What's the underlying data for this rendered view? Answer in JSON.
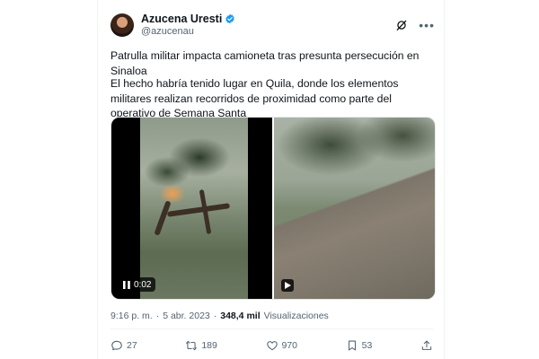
{
  "user": {
    "display_name": "Azucena Uresti",
    "handle": "@azucenau"
  },
  "post": {
    "line1": "Patrulla militar impacta camioneta tras presunta persecución en Sinaloa",
    "line2": "El hecho habría tenido lugar en Quila, donde los elementos militares realizan recorridos de proximidad como parte del operativo de Semana Santa"
  },
  "media": {
    "video1_time": "0:02"
  },
  "meta": {
    "time": "9:16 p. m.",
    "separator": "·",
    "date": "5 abr. 2023",
    "views_separator": "·",
    "views_count": "348,4 mil",
    "views_label": "Visualizaciones"
  },
  "actions": {
    "replies": "27",
    "reposts": "189",
    "likes": "970",
    "bookmarks": "53"
  },
  "icons": [
    "avatar",
    "verified-icon",
    "grok-icon",
    "more-icon",
    "pause-icon",
    "play-icon",
    "reply-icon",
    "repost-icon",
    "like-icon",
    "bookmark-icon",
    "share-icon"
  ],
  "colors": {
    "verified": "#1d9bf0",
    "secondary_text": "#536471",
    "primary_text": "#0f1419"
  }
}
